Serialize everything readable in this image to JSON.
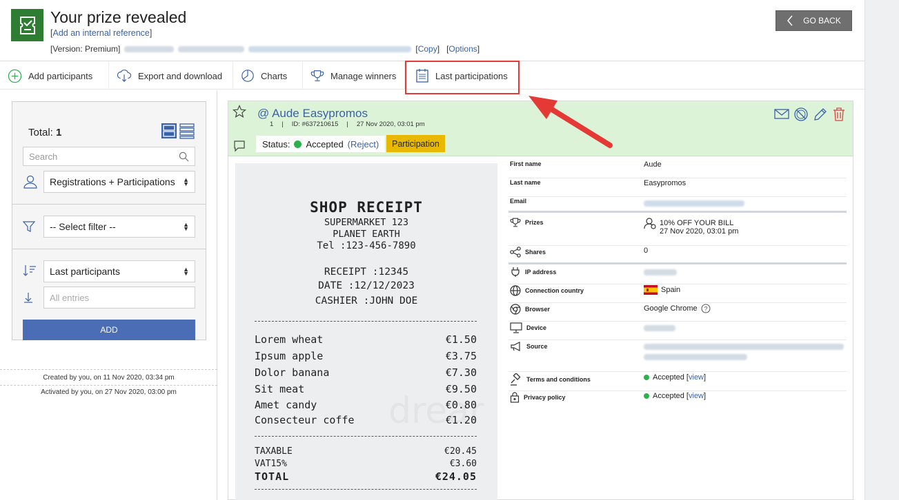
{
  "header": {
    "title": "Your prize revealed",
    "internal_ref": "Add an internal reference",
    "version_label": "[Version: Premium]",
    "copy_label": "Copy",
    "options_label": "Options",
    "go_back_label": "GO BACK"
  },
  "toolbar": {
    "items": [
      {
        "label": "Add participants",
        "icon": "add-circle-icon"
      },
      {
        "label": "Export and download",
        "icon": "cloud-download-icon"
      },
      {
        "label": "Charts",
        "icon": "pie-chart-icon"
      },
      {
        "label": "Manage winners",
        "icon": "trophy-icon"
      },
      {
        "label": "Last participations",
        "icon": "list-icon"
      }
    ]
  },
  "sidebar": {
    "total_label": "Total:",
    "total_value": "1",
    "search_placeholder": "Search",
    "type_select": "Registrations + Participations",
    "filter_select": "-- Select filter --",
    "sort_select": "Last participants",
    "entries_placeholder": "All entries",
    "add_button": "ADD",
    "created_text": "Created by you, on 11 Nov 2020, 03:34 pm",
    "activated_text": "Activated by you, on 27 Nov 2020, 03:00 pm"
  },
  "participant": {
    "at": "@",
    "name": "Aude Easypromos",
    "index": "1",
    "id": "ID: #637210615",
    "date": "27 Nov 2020, 03:01 pm",
    "status_label": "Status:",
    "status_value": "Accepted",
    "reject_label": "(Reject)",
    "badge": "Participation"
  },
  "receipt": {
    "title": "SHOP RECEIPT",
    "store": "SUPERMARKET 123",
    "location": "PLANET EARTH",
    "tel": "Tel :123-456-7890",
    "number": "RECEIPT :12345",
    "date": "DATE :12/12/2023",
    "cashier": "CASHIER :JOHN DOE",
    "items": [
      {
        "name": "Lorem wheat",
        "price": "€1.50"
      },
      {
        "name": "Ipsum apple",
        "price": "€3.75"
      },
      {
        "name": "Dolor banana",
        "price": "€7.30"
      },
      {
        "name": "Sit meat",
        "price": "€9.50"
      },
      {
        "name": "Amet candy",
        "price": "€0.80"
      },
      {
        "name": "Consecteur coffe",
        "price": "€1.20"
      }
    ],
    "taxable_label": "TAXABLE",
    "taxable_value": "€20.45",
    "vat_label": "VAT15%",
    "vat_value": "€3.60",
    "total_label": "TOTAL",
    "total_value": "€24.05",
    "watermark": "drear"
  },
  "details": {
    "first_name_label": "First name",
    "first_name": "Aude",
    "last_name_label": "Last name",
    "last_name": "Easypromos",
    "email_label": "Email",
    "prizes_label": "Prizes",
    "prize_name": "10% OFF YOUR BILL",
    "prize_date": "27 Nov 2020, 03:01 pm",
    "shares_label": "Shares",
    "shares": "0",
    "ip_label": "IP address",
    "country_label": "Connection country",
    "country": "Spain",
    "browser_label": "Browser",
    "browser": "Google Chrome",
    "device_label": "Device",
    "source_label": "Source",
    "terms_label": "Terms and conditions",
    "terms_value": "Accepted",
    "privacy_label": "Privacy policy",
    "privacy_value": "Accepted",
    "view_label": "view"
  },
  "colors": {
    "accent_blue": "#3a62a8",
    "logo_green": "#2e7d32",
    "header_green": "#dcf3d8",
    "badge_yellow": "#e8b900",
    "highlight_red": "#e53935"
  }
}
